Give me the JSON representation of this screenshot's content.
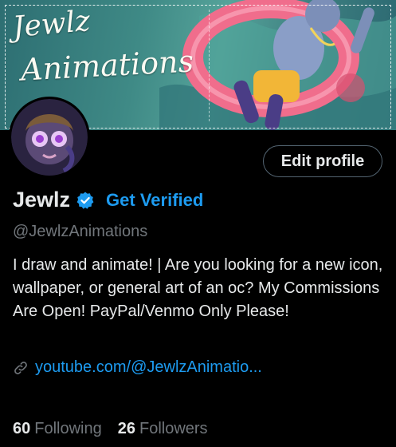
{
  "banner": {
    "title_line1": "Jewlz",
    "title_line2": "Animations"
  },
  "profile": {
    "display_name": "Jewlz",
    "get_verified_label": "Get Verified",
    "handle": "@JewlzAnimations",
    "bio": "I draw and animate! | Are you looking for a new icon, wallpaper, or general art of an oc? My Commissions Are Open! PayPal/Venmo Only Please!",
    "link_text": "youtube.com/@JewlzAnimatio...",
    "edit_label": "Edit profile"
  },
  "stats": {
    "following_count": "60",
    "following_label": "Following",
    "followers_count": "26",
    "followers_label": "Followers"
  },
  "icons": {
    "verified": "verified-badge-icon",
    "link": "link-icon"
  },
  "colors": {
    "background": "#000000",
    "text_primary": "#e7e9ea",
    "text_secondary": "#71767b",
    "accent": "#1d9bf0"
  }
}
